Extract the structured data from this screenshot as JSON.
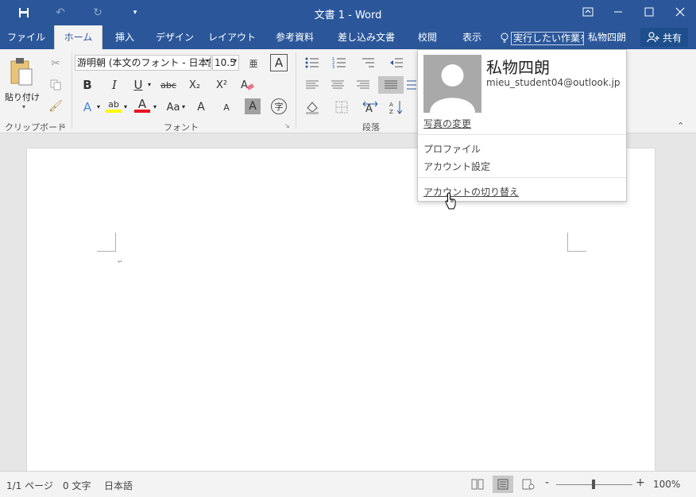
{
  "titlebar": {
    "title": "文書 1 - Word",
    "save_icon": "save-icon",
    "undo_icon": "undo-icon",
    "redo_icon": "redo-icon",
    "customize_icon": "customize-qat-icon",
    "ribbon_display_icon": "ribbon-display-options-icon",
    "minimize_icon": "minimize-icon",
    "maximize_icon": "maximize-icon",
    "close_icon": "close-icon"
  },
  "tabs": [
    {
      "label": "ファイル"
    },
    {
      "label": "ホーム"
    },
    {
      "label": "挿入"
    },
    {
      "label": "デザイン"
    },
    {
      "label": "レイアウト"
    },
    {
      "label": "参考資料"
    },
    {
      "label": "差し込み文書"
    },
    {
      "label": "校閲"
    },
    {
      "label": "表示"
    }
  ],
  "tellme": {
    "text": "実行したい作業を入"
  },
  "user": {
    "name": "私物四朗"
  },
  "share": {
    "label": "共有"
  },
  "ribbon": {
    "clipboard": {
      "paste_label": "貼り付け",
      "group_label": "クリップボード"
    },
    "font": {
      "font_name": "游明朝 (本文のフォント - 日本語",
      "font_size": "10.5",
      "group_label": "フォント",
      "bold": "B",
      "italic": "I",
      "underline": "U",
      "strike": "abc",
      "subscript": "X₂",
      "superscript": "X²",
      "case": "Aa",
      "grow": "A",
      "shrink": "A",
      "phonetic": "亜",
      "char_border": "A",
      "enclosed": "字",
      "text_effects": "A",
      "highlight": "ab",
      "font_color": "A",
      "char_shading": "A"
    },
    "paragraph": {
      "group_label": "段落"
    }
  },
  "account_popup": {
    "name": "私物四朗",
    "email": "mieu_student04@outlook.jp",
    "change_photo": "写真の変更",
    "profile": "プロファイル",
    "account_settings": "アカウント設定",
    "switch_account": "アカウントの切り替え"
  },
  "statusbar": {
    "page": "1/1 ページ",
    "words": "0 文字",
    "language": "日本語",
    "zoom": "100%",
    "zoom_minus": "-",
    "zoom_plus": "+"
  },
  "colors": {
    "accent": "#2b579a",
    "highlight": "#ffff00",
    "font_color": "#e81123"
  }
}
